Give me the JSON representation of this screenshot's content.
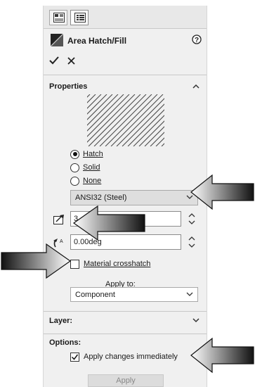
{
  "title": "Area Hatch/Fill",
  "sections": {
    "properties": "Properties",
    "layer": "Layer:",
    "options": "Options:"
  },
  "fill_type": {
    "options": [
      {
        "label": "Hatch",
        "selected": true
      },
      {
        "label": "Solid",
        "selected": false
      },
      {
        "label": "None",
        "selected": false
      }
    ]
  },
  "pattern": {
    "value": "ANSI32 (Steel)"
  },
  "scale": {
    "value": "3"
  },
  "angle": {
    "value": "0.00deg"
  },
  "material_crosshatch": {
    "label": "Material crosshatch",
    "checked": false
  },
  "apply_to": {
    "label": "Apply to:",
    "value": "Component"
  },
  "apply_changes": {
    "label": "Apply changes immediately",
    "checked": true
  },
  "apply_button": "Apply",
  "icons": [
    "property-tab-icon",
    "feature-tree-tab-icon",
    "hatch-icon",
    "help-icon",
    "ok-checkmark-icon",
    "cancel-x-icon",
    "chevron-up-icon",
    "chevron-down-icon",
    "scale-icon",
    "angle-icon",
    "callout-arrow"
  ],
  "colors": {
    "panel": "#f0f0f0",
    "dropdown": "#dedede",
    "text": "#1a1a1a"
  }
}
